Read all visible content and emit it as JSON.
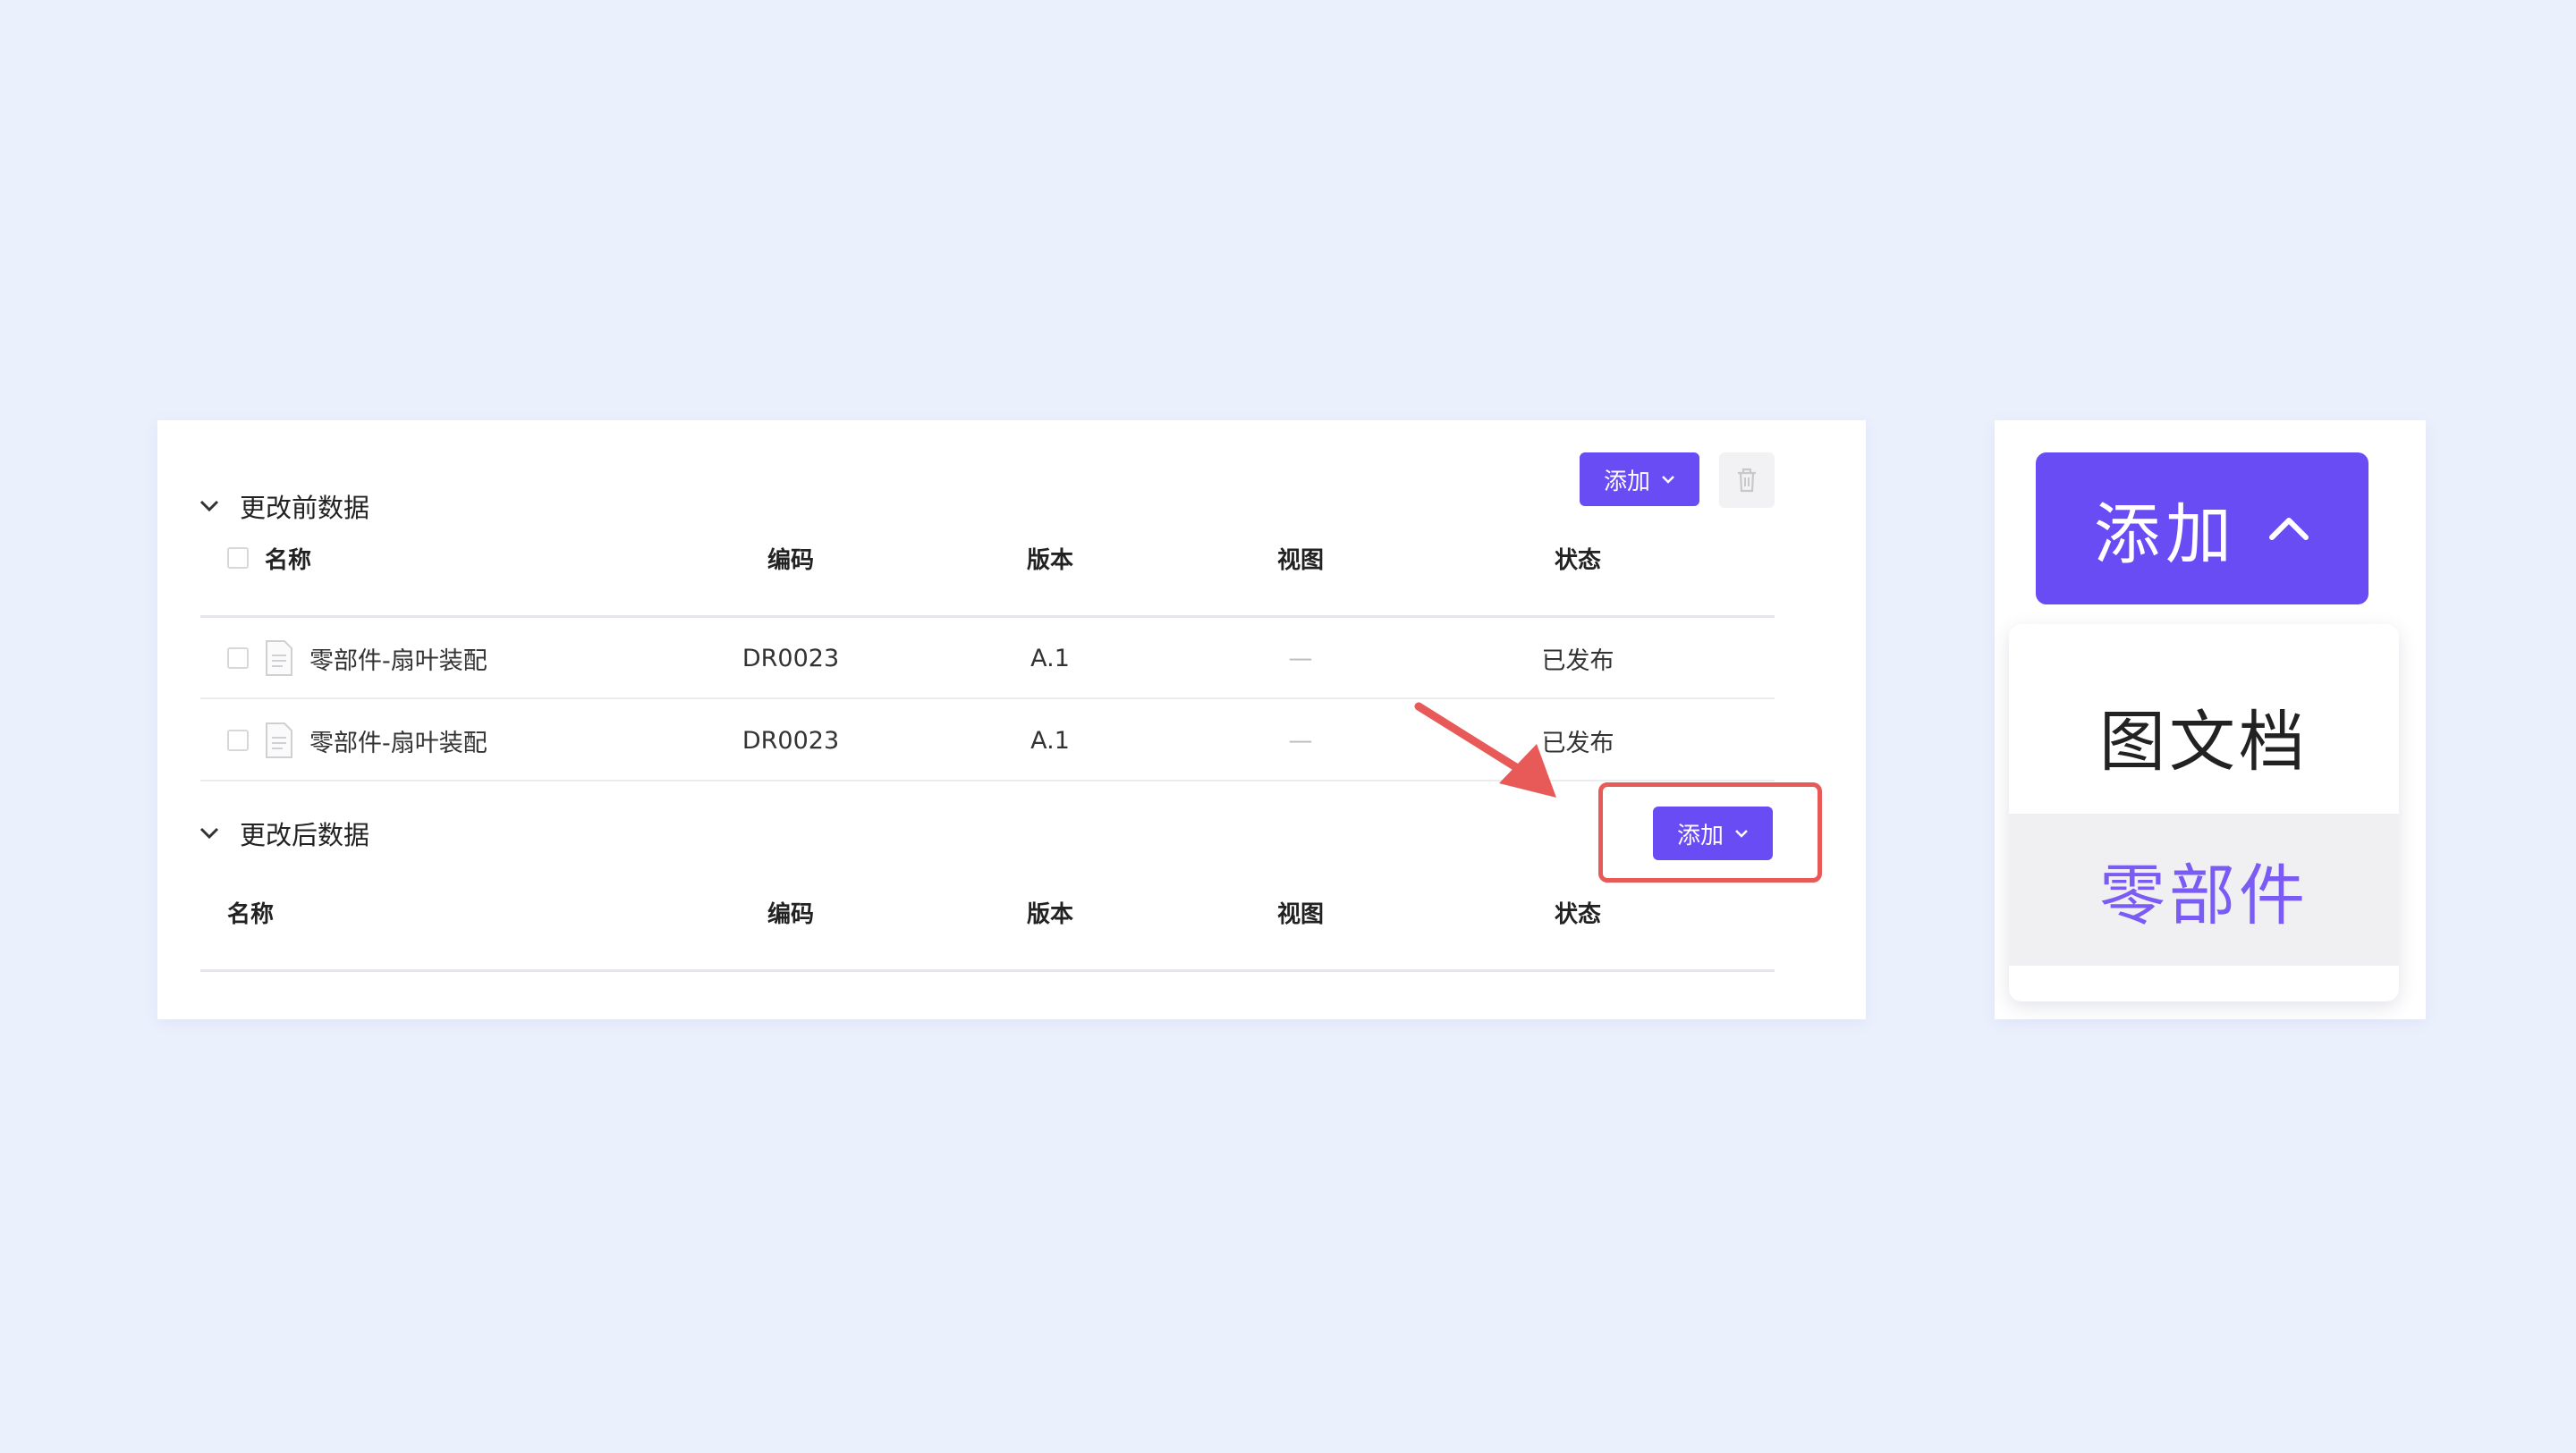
{
  "before_section": {
    "title": "更改前数据",
    "add_label": "添加",
    "columns": [
      "名称",
      "编码",
      "版本",
      "视图",
      "状态"
    ],
    "rows": [
      {
        "name": "零部件-扇叶装配",
        "code": "DR0023",
        "version": "A.1",
        "view": "—",
        "status": "已发布"
      },
      {
        "name": "零部件-扇叶装配",
        "code": "DR0023",
        "version": "A.1",
        "view": "—",
        "status": "已发布"
      }
    ]
  },
  "after_section": {
    "title": "更改后数据",
    "add_label": "添加",
    "columns": [
      "名称",
      "编码",
      "版本",
      "视图",
      "状态"
    ]
  },
  "zoom": {
    "add_label": "添加",
    "menu_items": [
      "图文档",
      "零部件"
    ],
    "hovered_item": "零部件"
  },
  "colors": {
    "primary": "#6a4cf5",
    "highlight_border": "#e85a58",
    "background": "#ebf0fd"
  }
}
